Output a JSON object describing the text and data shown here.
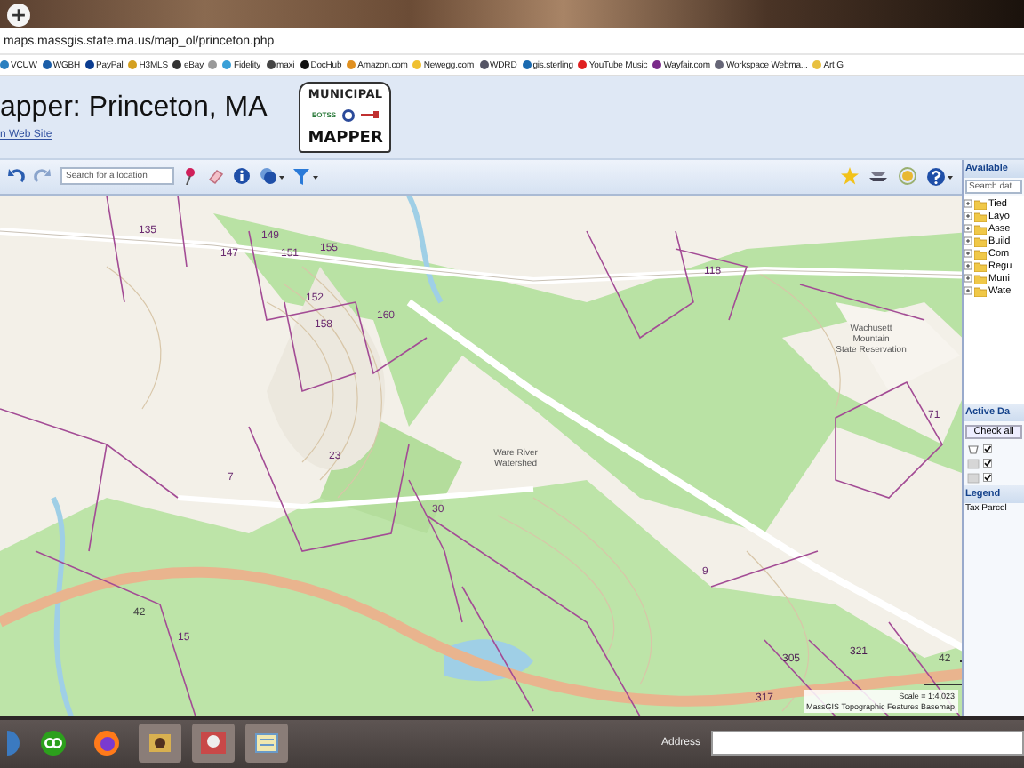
{
  "browser": {
    "new_tab": "+",
    "address": "maps.massgis.state.ma.us/map_ol/princeton.php",
    "bookmarks": [
      {
        "kind": "link",
        "label": "VCUW"
      },
      {
        "kind": "link",
        "label": "WGBH"
      },
      {
        "kind": "link",
        "label": "PayPal"
      },
      {
        "kind": "link",
        "label": "H3MLS"
      },
      {
        "kind": "link",
        "label": "eBay"
      },
      {
        "kind": "icon"
      },
      {
        "kind": "link",
        "label": "Fidelity"
      },
      {
        "kind": "link",
        "label": "maxi"
      },
      {
        "kind": "link",
        "label": "DocHub"
      },
      {
        "kind": "link",
        "label": "Amazon.com"
      },
      {
        "kind": "link",
        "label": "Newegg.com"
      },
      {
        "kind": "link",
        "label": "WDRD"
      },
      {
        "kind": "link",
        "label": "gis.sterling"
      },
      {
        "kind": "link",
        "label": "YouTube Music"
      },
      {
        "kind": "link",
        "label": "Wayfair.com"
      },
      {
        "kind": "link",
        "label": "Workspace Webma..."
      },
      {
        "kind": "link",
        "label": "Art G"
      }
    ]
  },
  "header": {
    "title": "apper: Princeton, MA",
    "link": "n Web Site",
    "logo": {
      "top": "MUNICIPAL",
      "badge": "EOTSS",
      "bottom": "MAPPER"
    }
  },
  "toolbar": {
    "search": {
      "placeholder": "Search for a location"
    }
  },
  "map": {
    "labels": [
      "135",
      "147",
      "149",
      "151",
      "155",
      "152",
      "158",
      "160",
      "118",
      "23",
      "7",
      "30",
      "71",
      "9",
      "15",
      "305",
      "321",
      "317",
      "42",
      "42",
      "Wachusett Mountain State Reservation",
      "Ware River Watershed"
    ],
    "scale": "Scale = 1:4,023",
    "credit": "MassGIS Topographic Features Basemap"
  },
  "panel": {
    "available_title": "Available",
    "search": {
      "placeholder": "Search dat"
    },
    "layers": [
      {
        "label": "Tied"
      },
      {
        "label": "Layo"
      },
      {
        "label": "Asse"
      },
      {
        "label": "Build"
      },
      {
        "label": "Com"
      },
      {
        "label": "Regu"
      },
      {
        "label": "Muni"
      },
      {
        "label": "Wate"
      }
    ],
    "active_title": "Active Da",
    "check_all": "Check all",
    "active_rows": [
      {
        "checked": true
      },
      {
        "checked": true
      },
      {
        "checked": true
      }
    ],
    "legend_title": "Legend",
    "legend_item": "Tax Parcel"
  },
  "taskbar": {
    "address_label": "Address"
  }
}
